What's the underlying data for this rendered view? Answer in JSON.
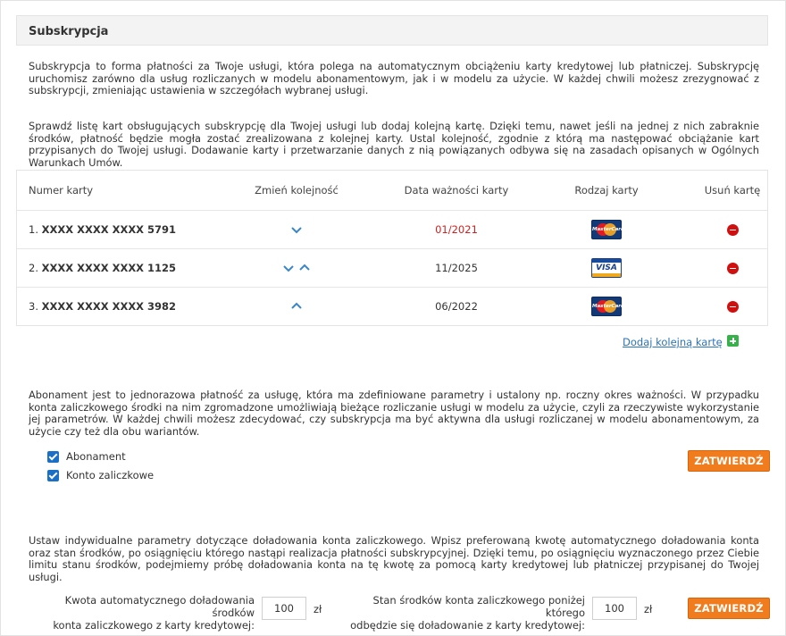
{
  "header": {
    "title": "Subskrypcja"
  },
  "intro": {
    "p1": "Subskrypcja to forma płatności za Twoje usługi, która polega na automatycznym obciążeniu karty kredytowej lub płatniczej. Subskrypcję uruchomisz zarówno dla usług rozliczanych w modelu abonamentowym, jak i w modelu za użycie. W każdej chwili możesz zrezygnować z subskrypcji, zmieniając ustawienia w szczegółach wybranej usługi.",
    "p2": "Sprawdź listę kart obsługujących subskrypcję dla Twojej usługi lub dodaj kolejną kartę. Dzięki temu, nawet jeśli na jednej z nich zabraknie środków, płatność będzie mogła zostać zrealizowana z kolejnej karty. Ustal kolejność, zgodnie z którą ma następować obciążanie kart przypisanych do Twojej usługi. Dodawanie karty i przetwarzanie danych z nią powiązanych odbywa się na zasadach opisanych w Ogólnych Warunkach Umów."
  },
  "table": {
    "headers": {
      "number": "Numer karty",
      "order": "Zmień kolejność",
      "expiry": "Data ważności karty",
      "type": "Rodzaj karty",
      "delete": "Usuń kartę"
    },
    "rows": [
      {
        "index": "1.",
        "number": "XXXX XXXX XXXX 5791",
        "expiry": "01/2021",
        "expired": true,
        "type": "MasterCard",
        "type_icon": "mastercard-icon",
        "can_up": false,
        "can_down": true
      },
      {
        "index": "2.",
        "number": "XXXX XXXX XXXX 1125",
        "expiry": "11/2025",
        "expired": false,
        "type": "VISA",
        "type_icon": "visa-icon",
        "can_up": true,
        "can_down": true
      },
      {
        "index": "3.",
        "number": "XXXX XXXX XXXX 3982",
        "expiry": "06/2022",
        "expired": false,
        "type": "MasterCard",
        "type_icon": "mastercard-icon",
        "can_up": true,
        "can_down": false
      }
    ]
  },
  "add_card": {
    "label": "Dodaj kolejną kartę",
    "icon": "plus-icon"
  },
  "subscription": {
    "description": "Abonament jest to jednorazowa płatność za usługę, która ma zdefiniowane parametry i ustalony np. roczny okres ważności. W przypadku konta zaliczkowego środki na nim zgromadzone umożliwiają bieżące rozliczanie usługi w modelu za użycie, czyli za rzeczywiste wykorzystanie jej parametrów. W każdej chwili możesz zdecydować, czy subskrypcja ma być aktywna dla usługi rozliczanej w modelu abonamentowym, za użycie czy też dla obu wariantów.",
    "options": [
      {
        "label": "Abonament",
        "checked": true
      },
      {
        "label": "Konto zaliczkowe",
        "checked": true
      }
    ],
    "submit_label": "ZATWIERDŹ"
  },
  "topup": {
    "description": "Ustaw indywidualne parametry dotyczące doładowania konta zaliczkowego. Wpisz preferowaną kwotę automatycznego doładowania konta oraz stan środków, po osiągnięciu którego nastąpi realizacja płatności subskrypcyjnej. Dzięki temu, po osiągnięciu wyznaczonego przez Ciebie limitu stanu środków, podejmiemy próbę doładowania konta na tę kwotę za pomocą karty kredytowej lub płatniczej przypisanej do Twojej usługi.",
    "amount_label_line1": "Kwota automatycznego doładowania środków",
    "amount_label_line2": "konta zaliczkowego z karty kredytowej:",
    "amount_value": "100",
    "threshold_label_line1": "Stan środków konta zaliczkowego poniżej którego",
    "threshold_label_line2": "odbędzie się doładowanie z karty kredytowej:",
    "threshold_value": "100",
    "currency": "zł",
    "submit_label": "ZATWIERDŹ"
  },
  "colors": {
    "accent_button": "#f07c1e",
    "expired_text": "#d21f1f",
    "link": "#2b73b7",
    "checkbox": "#1a6fc6",
    "delete": "#d00f0f",
    "add": "#37b24a"
  }
}
